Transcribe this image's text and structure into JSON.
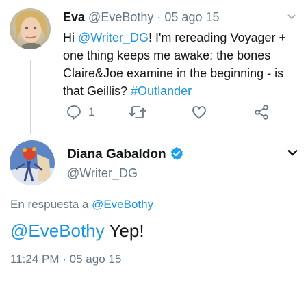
{
  "first_tweet": {
    "name": "Eva",
    "handle": "@EveBothy",
    "separator": "·",
    "date": "05 ago 15",
    "text_1": "Hi ",
    "mention": "@Writer_DG",
    "text_2": "! I'm rereading Voyager + one thing keeps me awake: the bones Claire&Joe examine in the beginning - is that Geillis? ",
    "hashtag": "#Outlander",
    "reply_count": "1",
    "icons": [
      "reply-icon",
      "retweet-icon",
      "like-icon",
      "share-icon",
      "chevron-down-icon"
    ]
  },
  "main_tweet": {
    "name": "Diana Gabaldon",
    "handle": "@Writer_DG",
    "verified": true,
    "in_reply_prefix": "En respuesta a ",
    "in_reply_handle": "@EveBothy",
    "body_mention": "@EveBothy",
    "body_text": " Yep!",
    "time": "11:24 PM",
    "separator": "·",
    "date": "05 ago 15"
  },
  "colors": {
    "link": "#1b95e0",
    "secondary_text": "#657786",
    "primary_text": "#14171a",
    "verified_badge": "#1da1f2",
    "divider": "#e6ecf0"
  }
}
